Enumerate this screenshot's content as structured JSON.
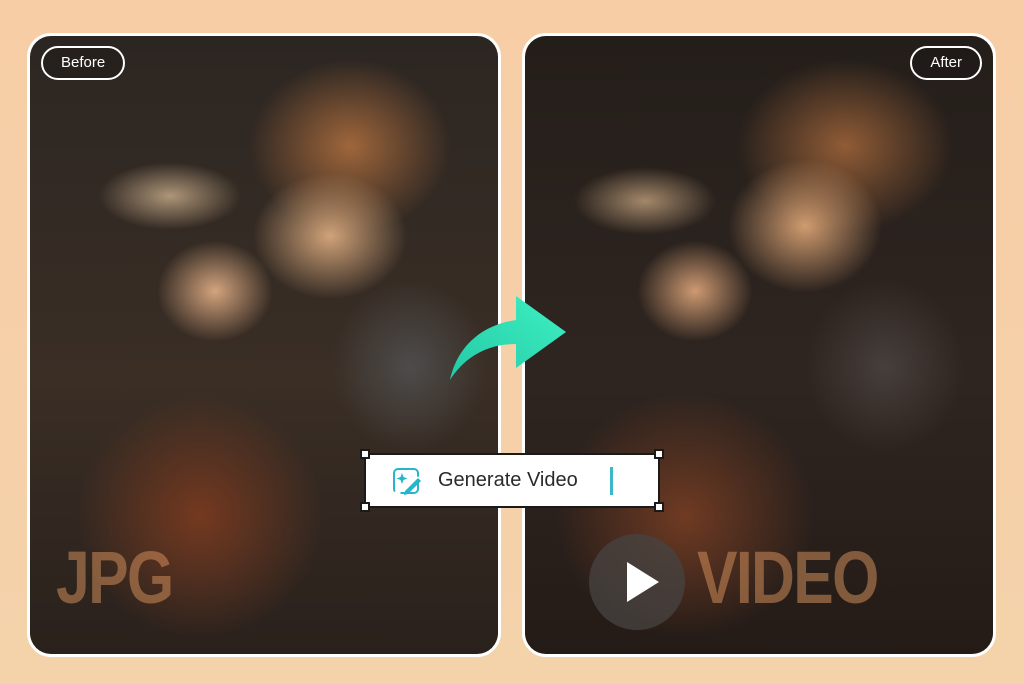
{
  "labels": {
    "before": "Before",
    "after": "After"
  },
  "watermarks": {
    "jpg": "JPG",
    "video": "VIDEO"
  },
  "generate": {
    "label": "Generate Video",
    "icon": "sparkle-edit-icon"
  },
  "icons": {
    "arrow": "curved-arrow-icon",
    "play": "play-icon"
  },
  "colors": {
    "background": "#f7cda6",
    "arrow": "#2ee0b5",
    "caret": "#3ab8c8",
    "icon_accent": "#27b6c9",
    "watermark": "#cd8c5a"
  }
}
